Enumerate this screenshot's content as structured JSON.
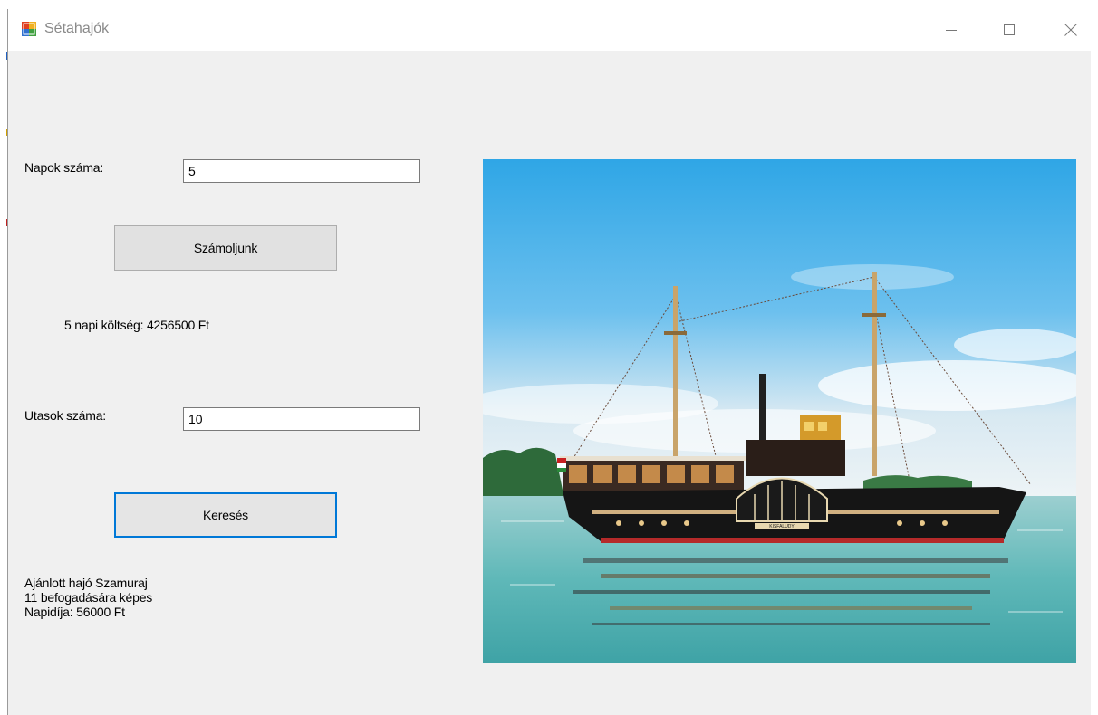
{
  "window": {
    "title": "Sétahajók",
    "controls": [
      "minimize",
      "maximize",
      "close"
    ]
  },
  "form": {
    "days_label": "Napok száma:",
    "days_value": "5",
    "calc_button": "Számoljunk",
    "cost_result": "5 napi költség: 4256500 Ft",
    "passengers_label": "Utasok száma:",
    "passengers_value": "10",
    "search_button": "Keresés",
    "recommendation": {
      "line1": "Ajánlott hajó Szamuraj",
      "line2": "11 befogadására képes",
      "line3": "Napidíja: 56000 Ft"
    }
  },
  "picture": {
    "icon": "paddle-steamer-photo",
    "ship_name": "KISFALUDY"
  },
  "colors": {
    "window_bg": "#f0f0f0",
    "focus_border": "#0078d7",
    "button_bg": "#e1e1e1",
    "sky_top": "#2fa6e6",
    "water": "#5fb8b8"
  }
}
